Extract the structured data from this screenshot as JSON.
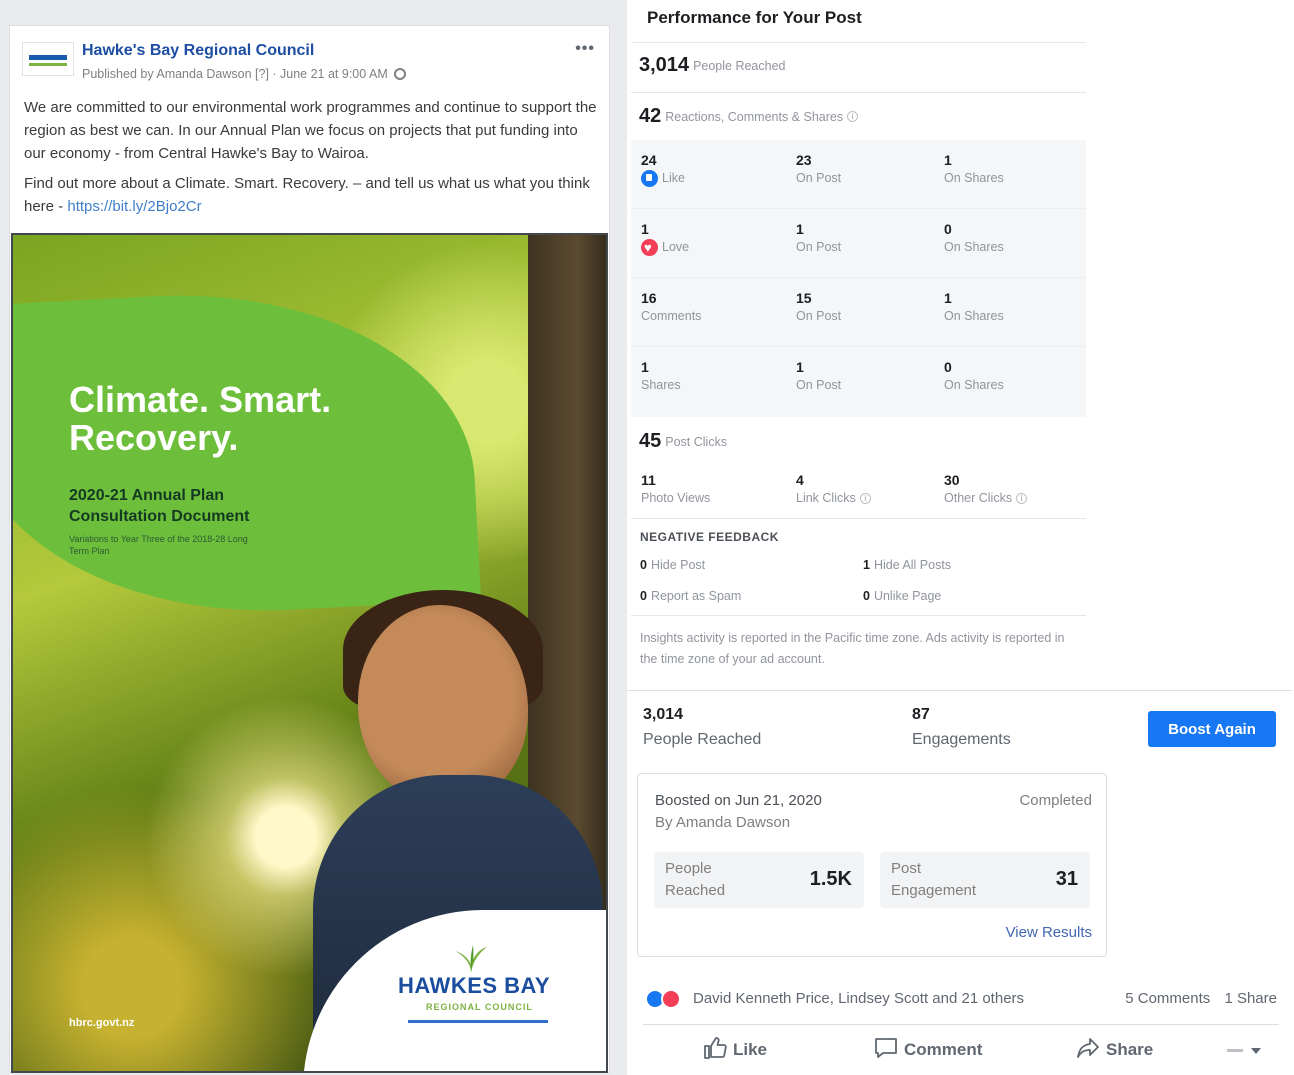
{
  "post": {
    "page_name": "Hawke's Bay Regional Council",
    "published_by": "Published by Amanda Dawson [?] · June 21 at 9:00 AM",
    "more": "•••",
    "paragraph1": "We are committed to our environmental work programmes and continue to support the region as best we can. In our Annual Plan we focus on projects that put funding into our economy - from Central Hawke's Bay to Wairoa.",
    "paragraph2_text": "Find out more about a Climate. Smart. Recovery. – and tell us what us what you think here - ",
    "link": "https://bit.ly/2Bjo2Cr",
    "image": {
      "title_line1": "Climate. Smart.",
      "title_line2": "Recovery.",
      "subtitle_line1": "2020-21 Annual Plan",
      "subtitle_line2": "Consultation Document",
      "small_text": "Variations to Year Three of the 2018-28 Long Term Plan",
      "logo_name": "HAWKES BAY",
      "logo_sub": "REGIONAL COUNCIL",
      "url": "hbrc.govt.nz"
    }
  },
  "insights": {
    "title": "Performance for Your Post",
    "people_reached": {
      "value": "3,014",
      "label": "People Reached"
    },
    "reactions_total": {
      "value": "42",
      "label": "Reactions, Comments & Shares"
    },
    "reaction_rows": [
      {
        "cells": [
          {
            "num": "24",
            "label": "Like",
            "icon": "like"
          },
          {
            "num": "23",
            "label": "On Post"
          },
          {
            "num": "1",
            "label": "On Shares"
          }
        ]
      },
      {
        "cells": [
          {
            "num": "1",
            "label": "Love",
            "icon": "love"
          },
          {
            "num": "1",
            "label": "On Post"
          },
          {
            "num": "0",
            "label": "On Shares"
          }
        ]
      },
      {
        "cells": [
          {
            "num": "16",
            "label": "Comments"
          },
          {
            "num": "15",
            "label": "On Post"
          },
          {
            "num": "1",
            "label": "On Shares"
          }
        ]
      },
      {
        "cells": [
          {
            "num": "1",
            "label": "Shares"
          },
          {
            "num": "1",
            "label": "On Post"
          },
          {
            "num": "0",
            "label": "On Shares"
          }
        ]
      }
    ],
    "post_clicks": {
      "value": "45",
      "label": "Post Clicks"
    },
    "clicks": [
      {
        "num": "11",
        "label": "Photo Views"
      },
      {
        "num": "4",
        "label": "Link Clicks"
      },
      {
        "num": "30",
        "label": "Other Clicks"
      }
    ],
    "negative_title": "NEGATIVE FEEDBACK",
    "negative": [
      {
        "num": "0",
        "label": "Hide Post"
      },
      {
        "num": "1",
        "label": "Hide All Posts"
      },
      {
        "num": "0",
        "label": "Report as Spam"
      },
      {
        "num": "0",
        "label": "Unlike Page"
      }
    ],
    "note": "Insights activity is reported in the Pacific time zone. Ads activity is reported in the time zone of your ad account."
  },
  "boost": {
    "people_reached": {
      "value": "3,014",
      "label": "People Reached"
    },
    "engagements": {
      "value": "87",
      "label": "Engagements"
    },
    "boost_again": "Boost Again",
    "boosted_on": "Boosted on Jun 21, 2020",
    "by": "By Amanda Dawson",
    "status": "Completed",
    "stat1": {
      "label": "People Reached",
      "value": "1.5K"
    },
    "stat2": {
      "label": "Post Engagement",
      "value": "31"
    },
    "view_results": "View Results"
  },
  "footer": {
    "reactors": "David Kenneth Price, Lindsey Scott and 21 others",
    "comments": "5 Comments",
    "shares": "1 Share",
    "like": "Like",
    "comment": "Comment",
    "share": "Share"
  },
  "colors": {
    "accent": "#1877f2",
    "page_name": "#1d4ea3",
    "like": "#1877f2",
    "love": "#f33e58"
  }
}
